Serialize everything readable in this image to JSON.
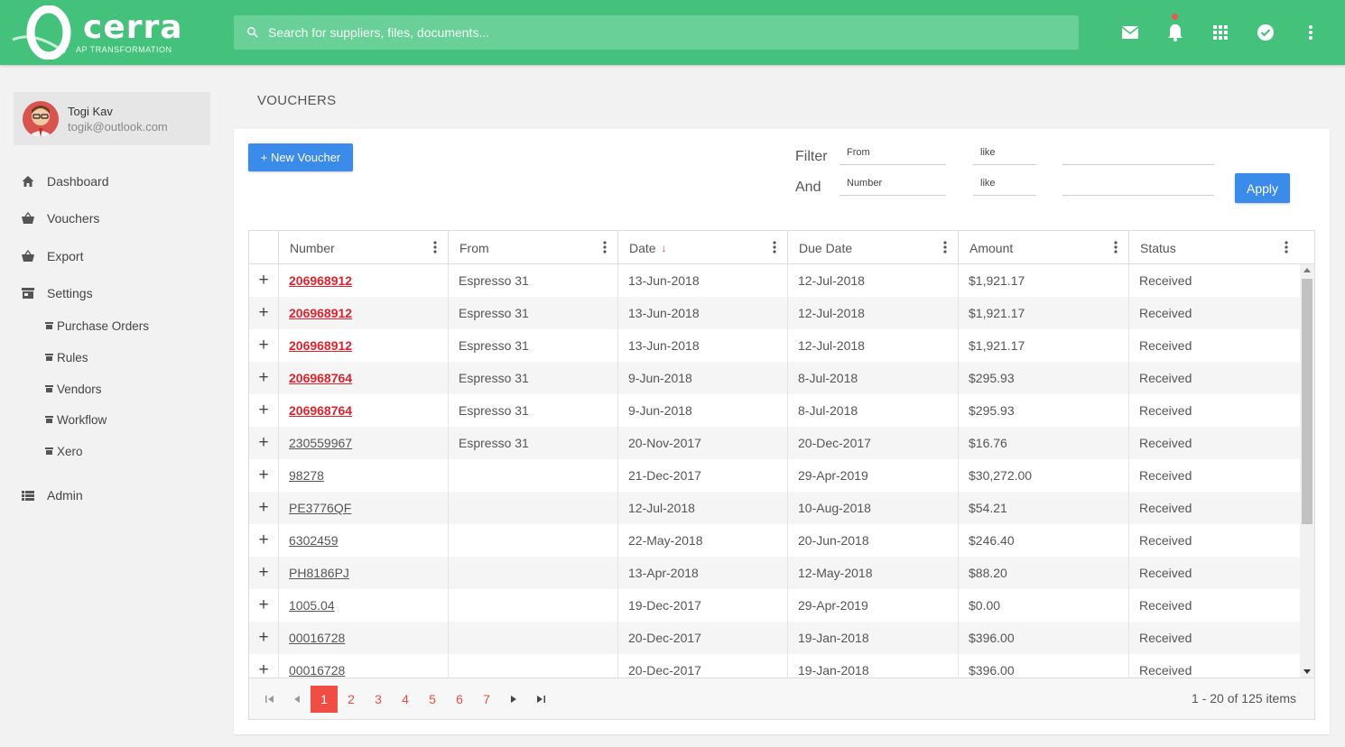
{
  "app": {
    "logo_text": "cerra",
    "logo_subtitle": "AP TRANSFORMATION",
    "search_placeholder": "Search for suppliers, files, documents...",
    "brand_color": "#44c17b"
  },
  "header_icons": [
    "mail-icon",
    "bell-icon",
    "apps-grid-icon",
    "check-circle-icon",
    "more-vert-icon"
  ],
  "user": {
    "name": "Togi Kav",
    "email": "togik@outlook.com"
  },
  "sidebar": {
    "items": [
      {
        "label": "Dashboard",
        "icon": "home-icon"
      },
      {
        "label": "Vouchers",
        "icon": "basket-icon"
      },
      {
        "label": "Export",
        "icon": "basket-icon"
      },
      {
        "label": "Settings",
        "icon": "store-icon"
      }
    ],
    "settings_children": [
      {
        "label": "Purchase Orders"
      },
      {
        "label": "Rules"
      },
      {
        "label": "Vendors"
      },
      {
        "label": "Workflow"
      },
      {
        "label": "Xero"
      }
    ],
    "admin": {
      "label": "Admin",
      "icon": "list-icon"
    }
  },
  "page": {
    "title": "VOUCHERS",
    "new_button": "+ New Voucher"
  },
  "filters": {
    "filter_label": "Filter",
    "and_label": "And",
    "row1": {
      "field": "From",
      "operator": "like",
      "value": ""
    },
    "row2": {
      "field": "Number",
      "operator": "like",
      "value": ""
    },
    "apply_label": "Apply"
  },
  "table": {
    "columns": [
      "Number",
      "From",
      "Date",
      "Due Date",
      "Amount",
      "Status"
    ],
    "sorted_column": "Date",
    "sort_direction": "descending",
    "rows": [
      {
        "number": "206968912",
        "from": "Espresso 31",
        "date": "13-Jun-2018",
        "due": "12-Jul-2018",
        "amount": "$1,921.17",
        "status": "Received",
        "highlight": true
      },
      {
        "number": "206968912",
        "from": "Espresso 31",
        "date": "13-Jun-2018",
        "due": "12-Jul-2018",
        "amount": "$1,921.17",
        "status": "Received",
        "highlight": true
      },
      {
        "number": "206968912",
        "from": "Espresso 31",
        "date": "13-Jun-2018",
        "due": "12-Jul-2018",
        "amount": "$1,921.17",
        "status": "Received",
        "highlight": true
      },
      {
        "number": "206968764",
        "from": "Espresso 31",
        "date": "9-Jun-2018",
        "due": "8-Jul-2018",
        "amount": "$295.93",
        "status": "Received",
        "highlight": true
      },
      {
        "number": "206968764",
        "from": "Espresso 31",
        "date": "9-Jun-2018",
        "due": "8-Jul-2018",
        "amount": "$295.93",
        "status": "Received",
        "highlight": true
      },
      {
        "number": "230559967",
        "from": "Espresso 31",
        "date": "20-Nov-2017",
        "due": "20-Dec-2017",
        "amount": "$16.76",
        "status": "Received",
        "highlight": false
      },
      {
        "number": "98278",
        "from": "",
        "date": "21-Dec-2017",
        "due": "29-Apr-2019",
        "amount": "$30,272.00",
        "status": "Received",
        "highlight": false
      },
      {
        "number": "PE3776QF",
        "from": "",
        "date": "12-Jul-2018",
        "due": "10-Aug-2018",
        "amount": "$54.21",
        "status": "Received",
        "highlight": false
      },
      {
        "number": "6302459",
        "from": "",
        "date": "22-May-2018",
        "due": "20-Jun-2018",
        "amount": "$246.40",
        "status": "Received",
        "highlight": false
      },
      {
        "number": "PH8186PJ",
        "from": "",
        "date": "13-Apr-2018",
        "due": "12-May-2018",
        "amount": "$88.20",
        "status": "Received",
        "highlight": false
      },
      {
        "number": "1005.04",
        "from": "",
        "date": "19-Dec-2017",
        "due": "29-Apr-2019",
        "amount": "$0.00",
        "status": "Received",
        "highlight": false
      },
      {
        "number": "00016728",
        "from": "",
        "date": "20-Dec-2017",
        "due": "19-Jan-2018",
        "amount": "$396.00",
        "status": "Received",
        "highlight": false
      },
      {
        "number": "00016728",
        "from": "",
        "date": "20-Dec-2017",
        "due": "19-Jan-2018",
        "amount": "$396.00",
        "status": "Received",
        "highlight": false
      }
    ]
  },
  "pagination": {
    "pages": [
      "1",
      "2",
      "3",
      "4",
      "5",
      "6",
      "7"
    ],
    "current": "1",
    "info": "1 - 20 of 125 items",
    "accent": "#f04e45"
  }
}
